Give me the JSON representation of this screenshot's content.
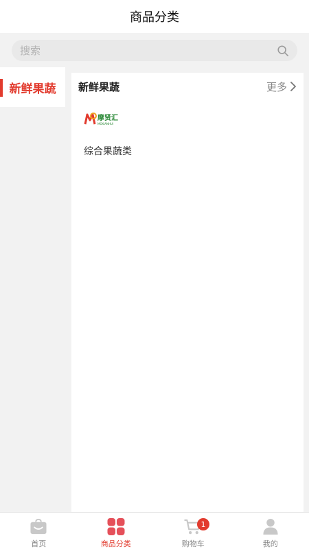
{
  "header": {
    "title": "商品分类"
  },
  "search": {
    "placeholder": "搜索",
    "value": ""
  },
  "sidebar": {
    "items": [
      {
        "label": "新鲜果蔬",
        "active": true
      }
    ]
  },
  "content": {
    "section_title": "新鲜果蔬",
    "more_label": "更多",
    "items": [
      {
        "name": "综合果蔬类",
        "logo_text": "摩贤汇",
        "logo_subtext": "MOXIANHUI"
      }
    ]
  },
  "tabbar": {
    "tabs": [
      {
        "label": "首页",
        "icon": "bag-icon"
      },
      {
        "label": "商品分类",
        "icon": "category-grid-icon",
        "active": true
      },
      {
        "label": "购物车",
        "icon": "cart-icon",
        "badge": "1"
      },
      {
        "label": "我的",
        "icon": "person-icon"
      }
    ]
  },
  "colors": {
    "accent": "#e23b2e",
    "background": "#f2f2f2",
    "logo_green": "#2e8b3a",
    "logo_red": "#e23b2e"
  }
}
